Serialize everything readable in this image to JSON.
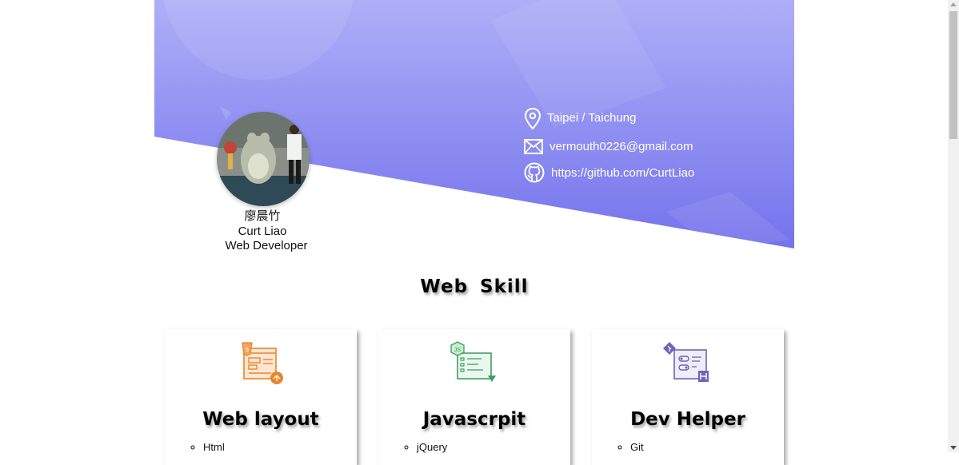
{
  "profile": {
    "name_chinese": "廖晨竹",
    "name_english": "Curt Liao",
    "title": "Web Developer"
  },
  "contacts": {
    "location": "Taipei / Taichung",
    "email": "vermouth0226@gmail.com",
    "github": "https://github.com/CurtLiao"
  },
  "section": {
    "title": "Web Skill"
  },
  "cards": [
    {
      "title": "Web layout",
      "items": [
        "Html"
      ]
    },
    {
      "title": "Javascrpit",
      "items": [
        "jQuery"
      ]
    },
    {
      "title": "Dev Helper",
      "items": [
        "Git"
      ]
    }
  ],
  "colors": {
    "hero_light": "#aaaaf7",
    "hero_dark": "#7c7bed",
    "html_icon": "#e8852a",
    "js_icon": "#3f9e5c",
    "dev_icon": "#6f64b7"
  }
}
